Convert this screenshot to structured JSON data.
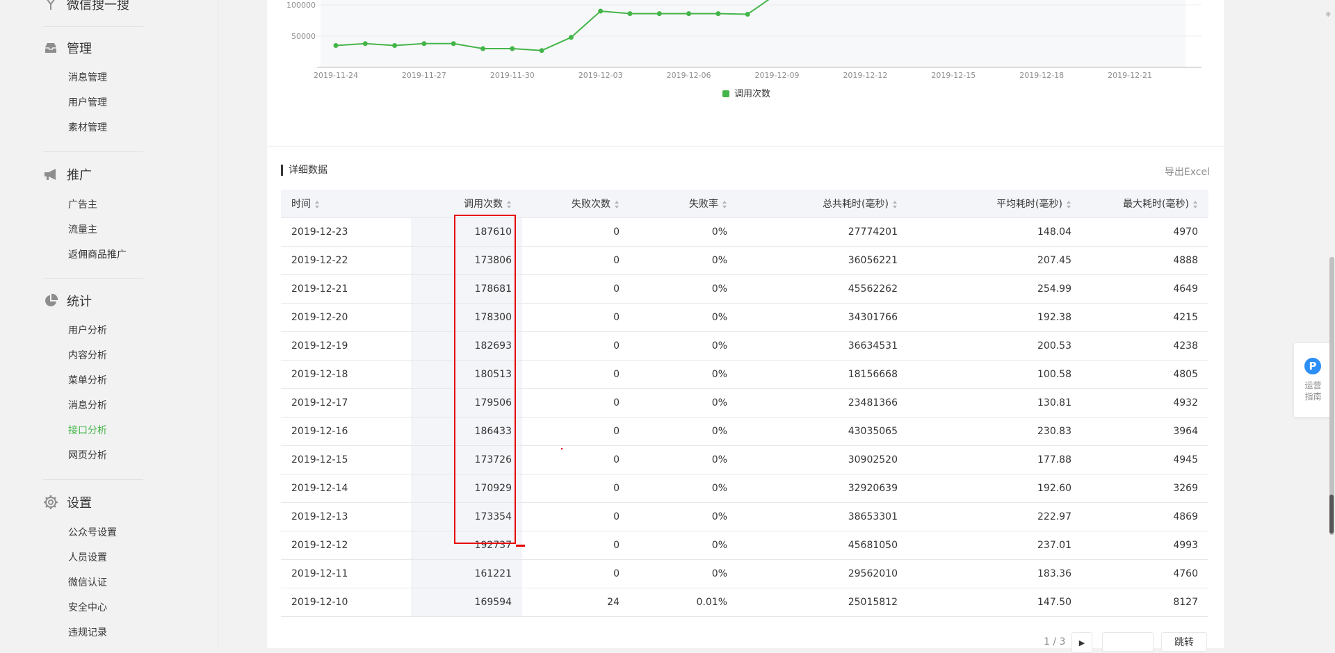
{
  "sidebar": {
    "top_partial": "微信搜一搜",
    "groups": [
      {
        "title": "管理",
        "icon": "inbox-icon",
        "items": [
          "消息管理",
          "用户管理",
          "素材管理"
        ]
      },
      {
        "title": "推广",
        "icon": "megaphone-icon",
        "items": [
          "广告主",
          "流量主",
          "返佣商品推广"
        ]
      },
      {
        "title": "统计",
        "icon": "pie-chart-icon",
        "items": [
          "用户分析",
          "内容分析",
          "菜单分析",
          "消息分析",
          "接口分析",
          "网页分析"
        ]
      },
      {
        "title": "设置",
        "icon": "gear-icon",
        "items": [
          "公众号设置",
          "人员设置",
          "微信认证",
          "安全中心",
          "违规记录"
        ]
      }
    ],
    "active_item": "接口分析",
    "active_color": "#44b549"
  },
  "chart_data": {
    "type": "line",
    "x": [
      "2019-11-24",
      "2019-11-25",
      "2019-11-26",
      "2019-11-27",
      "2019-11-28",
      "2019-11-29",
      "2019-11-30",
      "2019-12-01",
      "2019-12-02",
      "2019-12-03",
      "2019-12-04",
      "2019-12-05",
      "2019-12-06",
      "2019-12-07",
      "2019-12-08"
    ],
    "xticks": [
      "2019-11-24",
      "2019-11-27",
      "2019-11-30",
      "2019-12-03",
      "2019-12-06",
      "2019-12-09",
      "2019-12-12",
      "2019-12-15",
      "2019-12-18",
      "2019-12-21"
    ],
    "yticks": [
      "100000",
      "50000"
    ],
    "series": [
      {
        "name": "调用次数",
        "color": "#44b549",
        "values": [
          35000,
          38000,
          35000,
          38000,
          38000,
          30000,
          30000,
          27000,
          48000,
          90000,
          86000,
          86000,
          86000,
          86000,
          85000
        ]
      }
    ],
    "ylim": [
      0,
      150000
    ],
    "legend": "bottom-center",
    "grid": true
  },
  "table": {
    "section_title": "详细数据",
    "export_label": "导出Excel",
    "columns": [
      "时间",
      "调用次数",
      "失败次数",
      "失败率",
      "总共耗时(毫秒)",
      "平均耗时(毫秒)",
      "最大耗时(毫秒)"
    ],
    "rows": [
      [
        "2019-12-23",
        "187610",
        "0",
        "0%",
        "27774201",
        "148.04",
        "4970"
      ],
      [
        "2019-12-22",
        "173806",
        "0",
        "0%",
        "36056221",
        "207.45",
        "4888"
      ],
      [
        "2019-12-21",
        "178681",
        "0",
        "0%",
        "45562262",
        "254.99",
        "4649"
      ],
      [
        "2019-12-20",
        "178300",
        "0",
        "0%",
        "34301766",
        "192.38",
        "4215"
      ],
      [
        "2019-12-19",
        "182693",
        "0",
        "0%",
        "36634531",
        "200.53",
        "4238"
      ],
      [
        "2019-12-18",
        "180513",
        "0",
        "0%",
        "18156668",
        "100.58",
        "4805"
      ],
      [
        "2019-12-17",
        "179506",
        "0",
        "0%",
        "23481366",
        "130.81",
        "4932"
      ],
      [
        "2019-12-16",
        "186433",
        "0",
        "0%",
        "43035065",
        "230.83",
        "3964"
      ],
      [
        "2019-12-15",
        "173726",
        "0",
        "0%",
        "30902520",
        "177.88",
        "4945"
      ],
      [
        "2019-12-14",
        "170929",
        "0",
        "0%",
        "32920639",
        "192.60",
        "3269"
      ],
      [
        "2019-12-13",
        "173354",
        "0",
        "0%",
        "38653301",
        "222.97",
        "4869"
      ],
      [
        "2019-12-12",
        "192737",
        "0",
        "0%",
        "45681050",
        "237.01",
        "4993"
      ],
      [
        "2019-12-11",
        "161221",
        "0",
        "0%",
        "29562010",
        "183.36",
        "4760"
      ],
      [
        "2019-12-10",
        "169594",
        "24",
        "0.01%",
        "25015812",
        "147.50",
        "8127"
      ]
    ]
  },
  "pager": {
    "text": "1 / 3",
    "jump_label": "跳转",
    "next_icon": "caret-right-icon"
  },
  "guide": {
    "line1": "运营",
    "line2": "指南",
    "icon_letter": "P",
    "icon_color": "#2c8ef7"
  }
}
